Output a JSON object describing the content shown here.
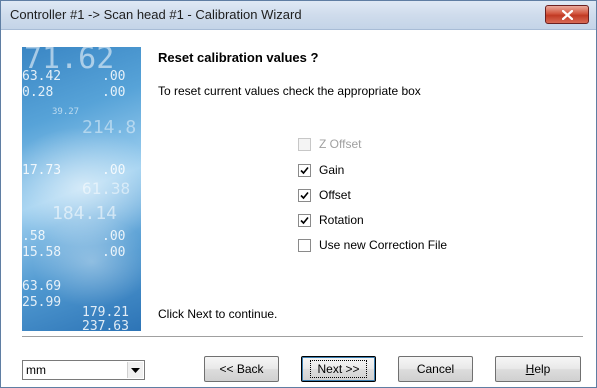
{
  "window": {
    "title": "Controller #1 -> Scan head #1 - Calibration Wizard"
  },
  "banner": {
    "numbers": [
      "71.62",
      "63.42",
      ".00",
      "0.28",
      ".00",
      "39.27",
      "214.8",
      "17.73",
      ".00",
      "61.38",
      "184.14",
      ".58",
      ".00",
      "15.58",
      ".00",
      "63.69",
      "25.99",
      "179.21",
      "237.63"
    ]
  },
  "page": {
    "heading": "Reset calibration values ?",
    "instruction": "To reset current values check the appropriate box",
    "continue_text": "Click Next to continue."
  },
  "options": [
    {
      "label": "Z Offset",
      "checked": false,
      "enabled": false
    },
    {
      "label": "Gain",
      "checked": true,
      "enabled": true
    },
    {
      "label": "Offset",
      "checked": true,
      "enabled": true
    },
    {
      "label": "Rotation",
      "checked": true,
      "enabled": true
    },
    {
      "label": "Use new Correction File",
      "checked": false,
      "enabled": true
    }
  ],
  "footer": {
    "units_value": "mm",
    "back_label": "<< Back",
    "next_label": "Next >>",
    "cancel_label": "Cancel",
    "help_label_underlined": "H",
    "help_label_rest": "elp"
  },
  "icons": {
    "close": "close-icon",
    "check": "checkmark-icon",
    "dropdown": "chevron-down-icon"
  },
  "colors": {
    "close_button": "#c13a24",
    "titlebar": "#cfdcec",
    "banner": "#4f98d0"
  }
}
